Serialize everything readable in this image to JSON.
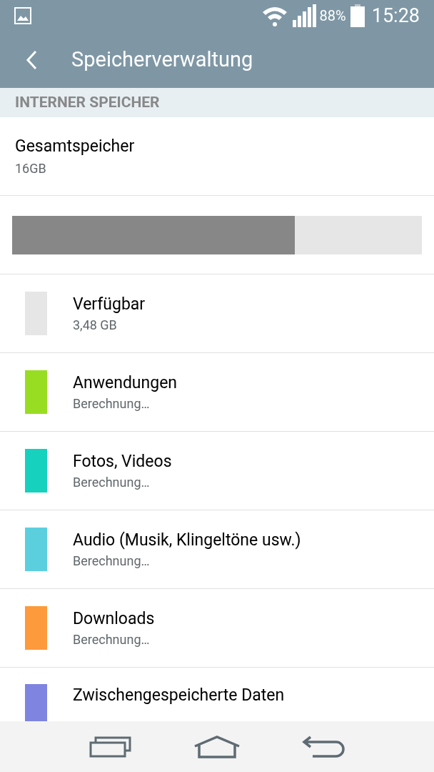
{
  "status_bar": {
    "battery": "88%",
    "time": "15:28"
  },
  "app_bar": {
    "title": "Speicherverwaltung"
  },
  "section": {
    "title": "INTERNER SPEICHER"
  },
  "total": {
    "label": "Gesamtspeicher",
    "value": "16GB"
  },
  "usage_bar": {
    "level": 0.69
  },
  "categories": [
    {
      "name": "Verfügbar",
      "value": "3,48 GB",
      "color": "#e6e6e6"
    },
    {
      "name": "Anwendungen",
      "value": "Berechnung…",
      "color": "#99dd22"
    },
    {
      "name": "Fotos, Videos",
      "value": "Berechnung…",
      "color": "#16d1bd"
    },
    {
      "name": "Audio (Musik, Klingeltöne usw.)",
      "value": "Berechnung…",
      "color": "#5ccfdf"
    },
    {
      "name": "Downloads",
      "value": "Berechnung…",
      "color": "#fd9a3c"
    },
    {
      "name": "Zwischengespeicherte Daten",
      "color": "#7f84e0"
    }
  ]
}
